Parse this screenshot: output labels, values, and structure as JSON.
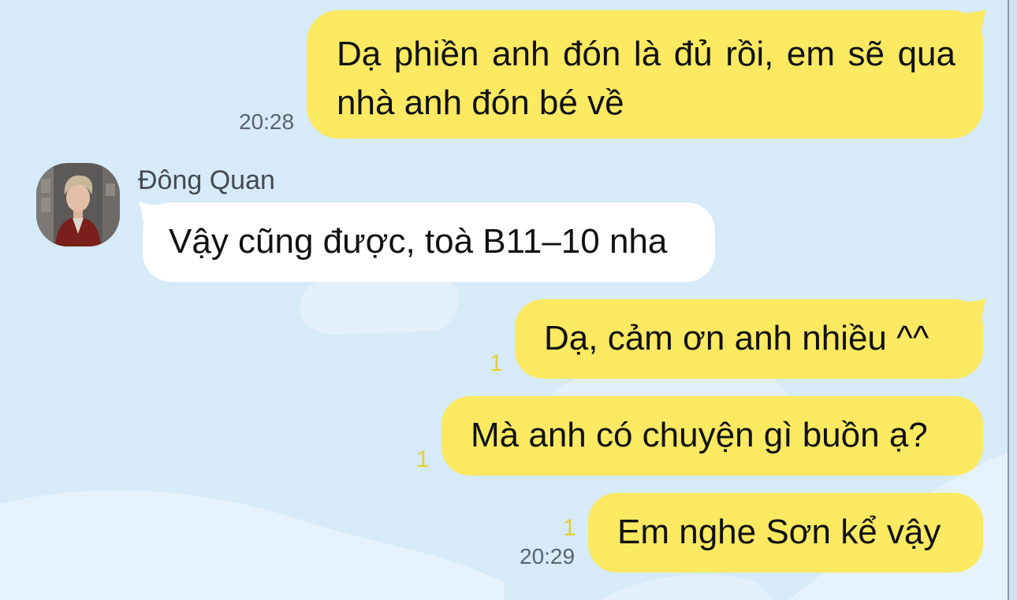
{
  "chat": {
    "messages": [
      {
        "direction": "outgoing",
        "text": "Dạ phiền anh đón là đủ rồi, em sẽ qua nhà anh đón bé về",
        "time": "20:28"
      },
      {
        "direction": "incoming",
        "sender": "Đông Quan",
        "text": "Vậy cũng được, toà B11–10 nha"
      },
      {
        "direction": "outgoing",
        "text": "Dạ, cảm ơn anh nhiều ^^",
        "unread": "1"
      },
      {
        "direction": "outgoing",
        "text": "Mà anh có chuyện gì buồn ạ?",
        "unread": "1"
      },
      {
        "direction": "outgoing",
        "text": "Em nghe Sơn kể vậy",
        "unread": "1",
        "time": "20:29"
      }
    ]
  },
  "colors": {
    "background": "#d6eaf8",
    "outgoing_bubble": "#fbe961",
    "incoming_bubble": "#ffffff",
    "unread_badge": "#e6ce38"
  }
}
